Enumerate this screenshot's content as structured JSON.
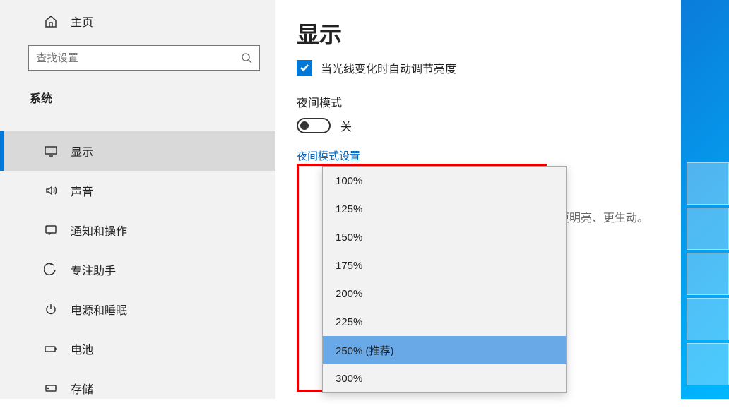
{
  "sidebar": {
    "home": "主页",
    "search_placeholder": "查找设置",
    "section": "系统",
    "items": [
      {
        "label": "显示",
        "icon": "monitor",
        "active": true
      },
      {
        "label": "声音",
        "icon": "sound",
        "active": false
      },
      {
        "label": "通知和操作",
        "icon": "notifications",
        "active": false
      },
      {
        "label": "专注助手",
        "icon": "focus",
        "active": false
      },
      {
        "label": "电源和睡眠",
        "icon": "power",
        "active": false
      },
      {
        "label": "电池",
        "icon": "battery",
        "active": false
      },
      {
        "label": "存储",
        "icon": "storage",
        "active": false
      }
    ]
  },
  "content": {
    "title": "显示",
    "brightness_checkbox": "当光线变化时自动调节亮度",
    "night_mode_label": "夜间模式",
    "night_mode_state": "关",
    "night_mode_link": "夜间模式设置",
    "partial_text": "更明亮、更生动。"
  },
  "scale_dropdown": {
    "options": [
      "100%",
      "125%",
      "150%",
      "175%",
      "200%",
      "225%",
      "250% (推荐)",
      "300%"
    ],
    "selected_index": 6
  }
}
